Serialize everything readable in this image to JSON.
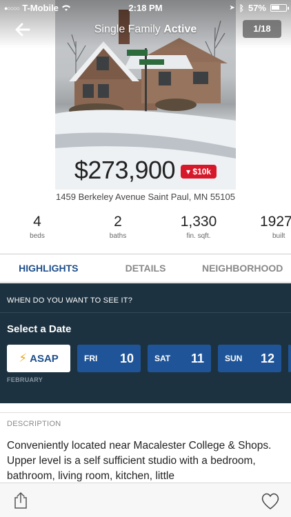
{
  "status_bar": {
    "carrier": "T-Mobile",
    "time": "2:18 PM",
    "battery_text": "57%",
    "battery_level": 0.57
  },
  "header": {
    "type_label": "Single Family",
    "status_label": "Active",
    "photo_counter": "1/18"
  },
  "listing": {
    "price": "$273,900",
    "price_drop": "▾ $10k",
    "address": "1459 Berkeley Avenue Saint Paul, MN 55105"
  },
  "stats": [
    {
      "value": "4",
      "label": "beds"
    },
    {
      "value": "2",
      "label": "baths"
    },
    {
      "value": "1,330",
      "label": "fin. sqft."
    },
    {
      "value": "1927",
      "label": "built"
    }
  ],
  "tabs": [
    {
      "label": "HIGHLIGHTS",
      "active": true
    },
    {
      "label": "DETAILS",
      "active": false
    },
    {
      "label": "NEIGHBORHOOD",
      "active": false
    }
  ],
  "schedule": {
    "question": "WHEN DO YOU WANT TO SEE IT?",
    "title": "Select a Date",
    "asap_label": "ASAP",
    "month": "FEBRUARY",
    "days": [
      {
        "name": "FRI",
        "date": "10"
      },
      {
        "name": "SAT",
        "date": "11"
      },
      {
        "name": "SUN",
        "date": "12"
      }
    ]
  },
  "description": {
    "label": "DESCRIPTION",
    "text": "Conveniently located near Macalester College & Shops.  Upper level is a self sufficient studio with a bedroom, bathroom, living room, kitchen, little"
  },
  "colors": {
    "accent": "#1d4e8a",
    "schedule_bg": "#1d3240",
    "day_button": "#1f5598",
    "price_drop": "#d7182a"
  },
  "icons": {
    "back": "arrow-left-icon",
    "share": "share-icon",
    "favorite": "heart-icon",
    "asap": "lightning-icon"
  }
}
